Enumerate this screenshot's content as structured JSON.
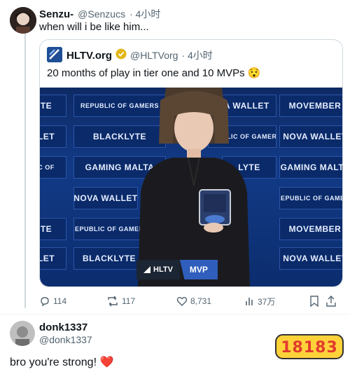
{
  "main_post": {
    "author_name": "Senzu-",
    "author_handle": "@Senzucs",
    "time": "· 4小时",
    "text": "when will i be like him..."
  },
  "quoted_post": {
    "author_name": "HLTV.org",
    "author_handle": "@HLTVorg",
    "time": "· 4小时",
    "text": "20 months of play in tier one and 10 MVPs 😯",
    "media": {
      "sponsors": [
        "REPUBLIC OF GAMERS",
        "NOVA WALLET",
        "MOVEMBER",
        "BLACKLYTE",
        "GAMING MALTA"
      ],
      "bottom_badge": {
        "brand": "HLTV",
        "label": "MVP"
      }
    }
  },
  "actions": {
    "replies": "114",
    "reposts": "117",
    "likes": "8,731",
    "views": "37万"
  },
  "reply": {
    "author_name": "donk1337",
    "author_handle": "@donk1337",
    "text": "bro you're strong! ❤️"
  },
  "watermark": {
    "text": "18183"
  },
  "colors": {
    "accent": "#1d9bf0",
    "verified": "#e2b719",
    "secondary_text": "#536471",
    "media_bg": "#0e2a64"
  },
  "icons": [
    "reply-icon",
    "repost-icon",
    "like-icon",
    "views-icon",
    "bookmark-icon",
    "share-icon",
    "verified-badge-icon",
    "heart-emoji-icon"
  ]
}
